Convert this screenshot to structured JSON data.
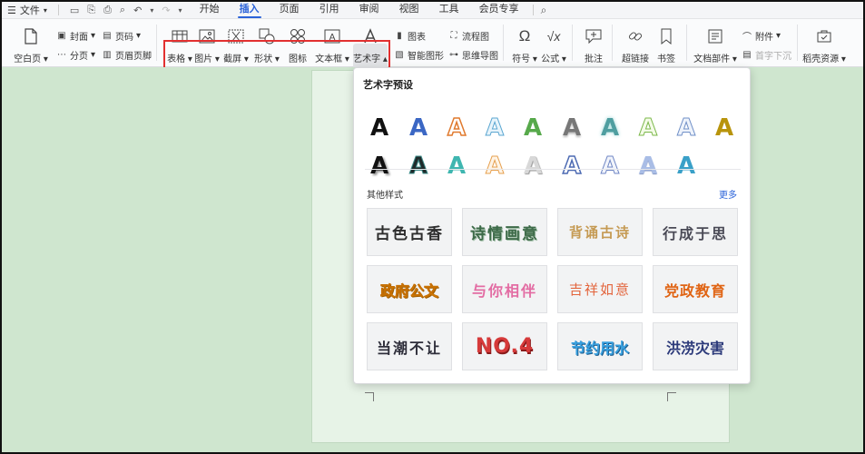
{
  "menu": {
    "file_label": "文件",
    "tabs": [
      {
        "label": "开始"
      },
      {
        "label": "插入"
      },
      {
        "label": "页面"
      },
      {
        "label": "引用"
      },
      {
        "label": "审阅"
      },
      {
        "label": "视图"
      },
      {
        "label": "工具"
      },
      {
        "label": "会员专享"
      }
    ]
  },
  "ribbon": {
    "blank_page": "空白页",
    "cover": "封面",
    "page_break": "分页",
    "page_number": "页码",
    "header_footer": "页眉页脚",
    "table": "表格",
    "picture": "图片",
    "screenshot": "截屏",
    "shape": "形状",
    "icons": "图标",
    "textbox": "文本框",
    "wordart": "艺术字",
    "chart": "图表",
    "smart_graphic": "智能图形",
    "flowchart": "流程图",
    "mindmap": "思维导图",
    "symbol": "符号",
    "formula": "公式",
    "comment": "批注",
    "hyperlink": "超链接",
    "bookmark": "书签",
    "doc_parts": "文档部件",
    "attachment": "附件",
    "drop_cap": "首字下沉",
    "template_resources": "稻壳资源"
  },
  "panel": {
    "title": "艺术字预设",
    "preset_glyph": "A",
    "other_title": "其他样式",
    "more": "更多",
    "styles": [
      "古色古香",
      "诗情画意",
      "背诵古诗",
      "行成于思",
      "政府公文",
      "与你相伴",
      "吉祥如意",
      "党政教育",
      "当潮不让",
      "NO.4",
      "节约用水",
      "洪涝灾害"
    ]
  },
  "colors": {
    "accent": "#2b63d9",
    "highlight_box": "#e23030",
    "canvas_bg": "#cfe6cf"
  }
}
